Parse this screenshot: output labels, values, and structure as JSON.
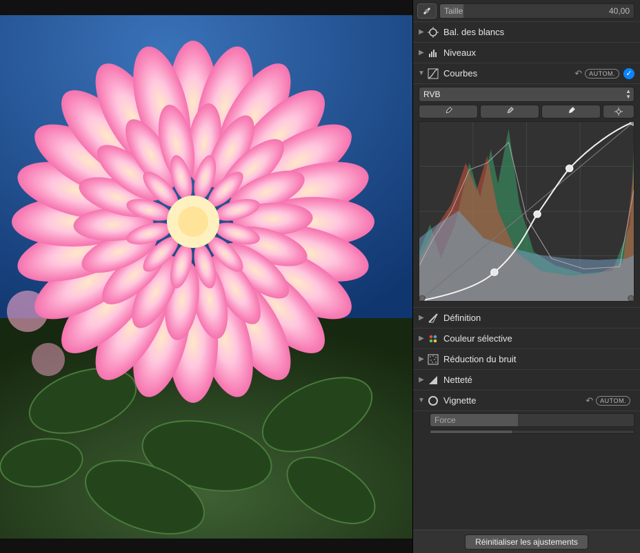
{
  "size_slider": {
    "label": "Taille",
    "value": "40,00"
  },
  "adjustments": {
    "white_balance": "Bal. des blancs",
    "levels": "Niveaux",
    "curves": "Courbes",
    "definition": "Définition",
    "selective_color": "Couleur sélective",
    "noise_reduction": "Réduction du bruit",
    "sharpen": "Netteté",
    "vignette": "Vignette"
  },
  "auto_label": "AUTOM.",
  "curves": {
    "channel": "RVB",
    "control_points": [
      {
        "x": 0,
        "y": 0
      },
      {
        "x": 0.35,
        "y": 0.16
      },
      {
        "x": 0.55,
        "y": 0.48
      },
      {
        "x": 0.7,
        "y": 0.74
      },
      {
        "x": 1.0,
        "y": 1.0
      }
    ]
  },
  "vignette": {
    "force_label": "Force"
  },
  "reset_button": "Réinitialiser les ajustements"
}
